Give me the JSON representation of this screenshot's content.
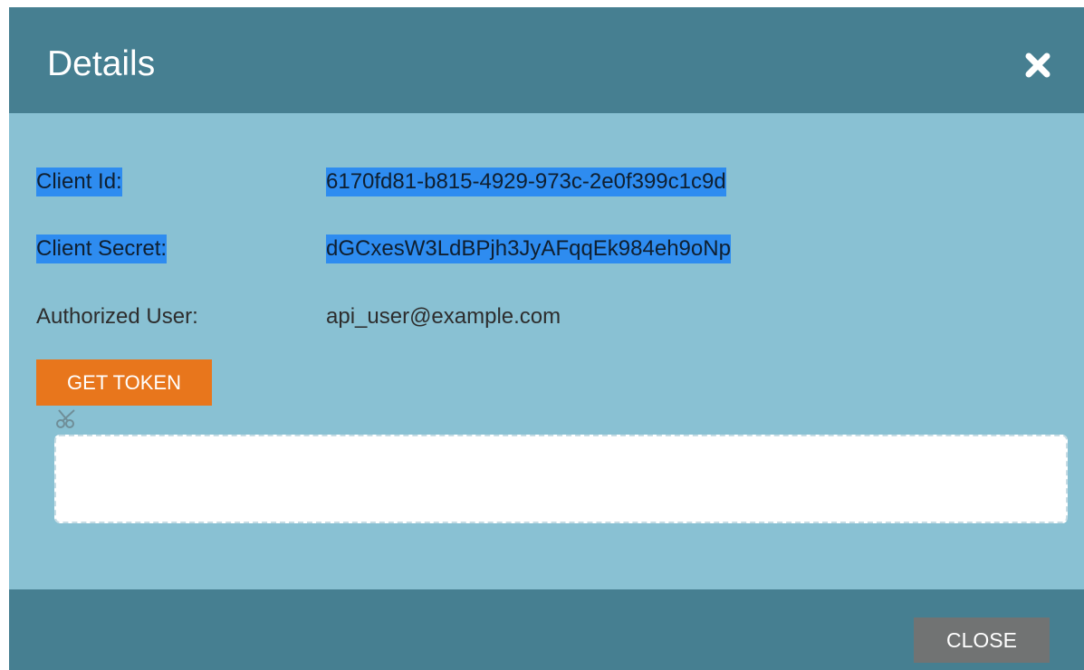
{
  "dialog": {
    "title": "Details",
    "close_icon": "close-x-icon"
  },
  "fields": {
    "client_id": {
      "label": "Client Id:",
      "value": "6170fd81-b815-4929-973c-2e0f399c1c9d",
      "selected": true
    },
    "client_secret": {
      "label": "Client Secret:",
      "value": "dGCxesW3LdBPjh3JyAFqqEk984eh9oNp",
      "selected": true
    },
    "authorized_user": {
      "label": "Authorized User:",
      "value": "api_user@example.com",
      "selected": false
    }
  },
  "actions": {
    "get_token_label": "GET TOKEN",
    "close_label": "CLOSE"
  },
  "token_box": {
    "icon": "scissors-icon",
    "value": ""
  },
  "colors": {
    "header_bg": "#467f91",
    "body_bg": "#89c1d3",
    "get_token_bg": "#e8761c",
    "close_button_bg": "#717373",
    "selection_bg": "#2e8cf0"
  }
}
